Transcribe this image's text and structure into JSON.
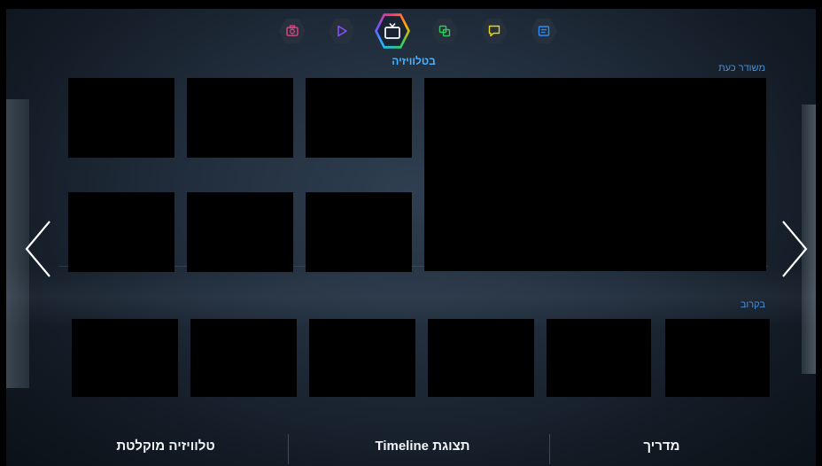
{
  "hub": {
    "title": "בטלוויזיה",
    "icons": [
      {
        "name": "photo-camera-icon",
        "color": "#e0417d"
      },
      {
        "name": "play-icon",
        "color": "#8c4dff"
      },
      {
        "name": "tv-icon",
        "color": "#ffffff",
        "active": true
      },
      {
        "name": "multiscreen-icon",
        "color": "#32c85a"
      },
      {
        "name": "chat-icon",
        "color": "#f0d400"
      },
      {
        "name": "web-browser-icon",
        "color": "#2a8cff"
      }
    ]
  },
  "sections": {
    "on_now": "משודר כעת",
    "coming_up": "בקרוב"
  },
  "bottom": {
    "guide": "מדריך",
    "timeline": "תצוגת Timeline",
    "recorded": "טלוויזיה מוקלטת"
  }
}
